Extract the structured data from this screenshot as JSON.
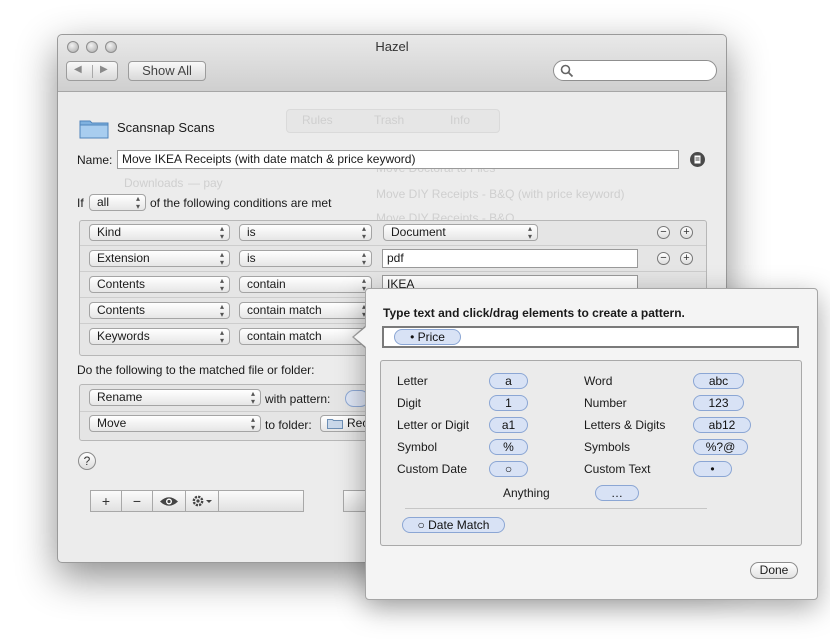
{
  "window": {
    "title": "Hazel",
    "nav_back": "◀",
    "nav_forward": "▶",
    "show_all": "Show All",
    "search_placeholder": ""
  },
  "background_faded": {
    "tabs": [
      "Rules",
      "Trash",
      "Info"
    ],
    "rules_list": [
      "Move Doctoral to Files",
      "Move DIY Receipts - B&Q (with price keyword)",
      "Move DIY Receipts - B&Q"
    ],
    "folder_item": "Downloads",
    "folder_item_suffix": "— pay"
  },
  "rule_editor": {
    "folder_name": "Scansnap Scans",
    "name_label": "Name:",
    "name_value": "Move IKEA Receipts (with date match & price keyword)",
    "if_label": "If",
    "match_mode": "all",
    "conditions_suffix": "of the following conditions are met",
    "conditions": [
      {
        "attribute": "Kind",
        "operator": "is",
        "value": "Document"
      },
      {
        "attribute": "Extension",
        "operator": "is",
        "value": "pdf"
      },
      {
        "attribute": "Contents",
        "operator": "contain",
        "value": "IKEA"
      },
      {
        "attribute": "Contents",
        "operator": "contain match",
        "value": ""
      },
      {
        "attribute": "Keywords",
        "operator": "contain match",
        "value": ""
      }
    ],
    "actions_label": "Do the following to the matched file or folder:",
    "actions": [
      {
        "action": "Rename",
        "connector": "with pattern:"
      },
      {
        "action": "Move",
        "connector": "to folder:",
        "target": "Rec"
      }
    ],
    "help": "?",
    "remove_glyph": "−",
    "add_glyph": "+"
  },
  "bottom_toolbar": {
    "add": "+",
    "remove": "−",
    "preview_icon": "eye-icon",
    "settings_icon": "gear-icon"
  },
  "pattern_popover": {
    "instruction": "Type text and click/drag elements to create a pattern.",
    "current_token": "• Price",
    "elements_left": [
      {
        "label": "Letter",
        "token": "a"
      },
      {
        "label": "Digit",
        "token": "1"
      },
      {
        "label": "Letter or Digit",
        "token": "a1"
      },
      {
        "label": "Symbol",
        "token": "%"
      },
      {
        "label": "Custom Date",
        "token": "○"
      }
    ],
    "elements_right": [
      {
        "label": "Word",
        "token": "abc"
      },
      {
        "label": "Number",
        "token": "123"
      },
      {
        "label": "Letters & Digits",
        "token": "ab12"
      },
      {
        "label": "Symbols",
        "token": "%?@"
      },
      {
        "label": "Custom Text",
        "token": "•"
      }
    ],
    "anything_label": "Anything",
    "anything_token": "…",
    "date_match": "○ Date Match",
    "done": "Done"
  }
}
